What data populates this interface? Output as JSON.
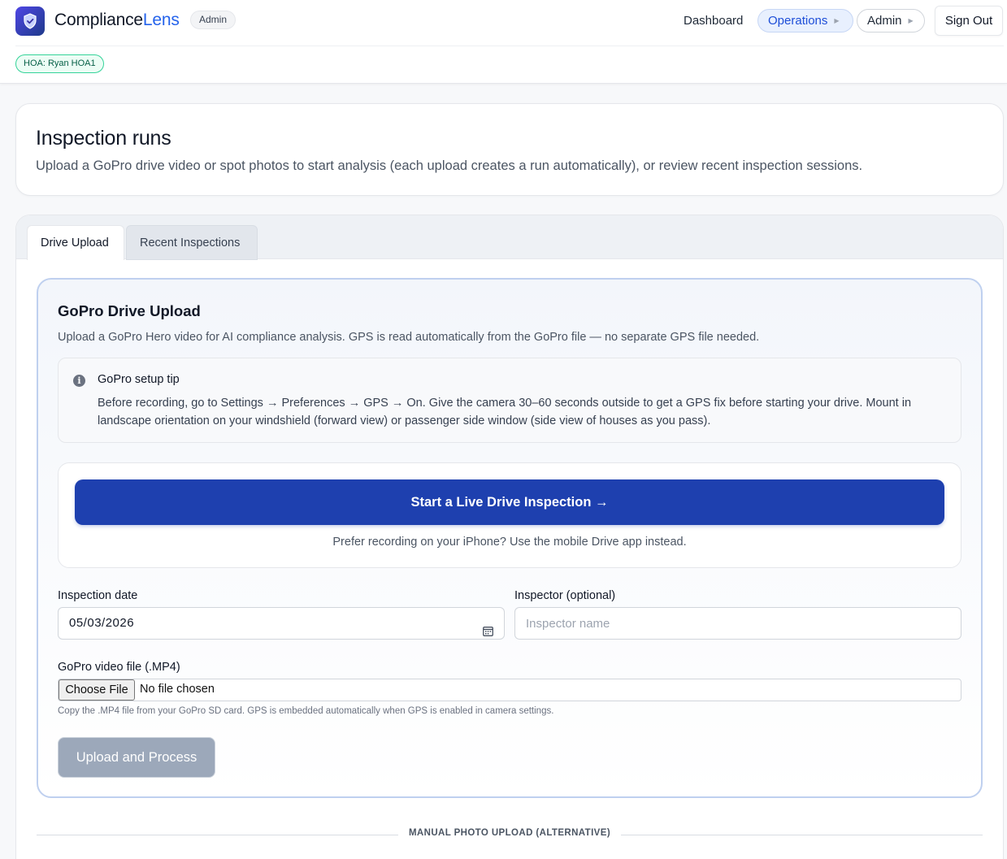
{
  "header": {
    "brand_primary": "Compliance",
    "brand_accent": "Lens",
    "role_badge": "Admin",
    "hoa_badge": "HOA: Ryan HOA1",
    "nav": {
      "dashboard": "Dashboard",
      "operations": "Operations",
      "admin": "Admin"
    },
    "sign_out": "Sign Out"
  },
  "page": {
    "title": "Inspection runs",
    "subtitle": "Upload a GoPro drive video or spot photos to start analysis (each upload creates a run automatically), or review recent inspection sessions."
  },
  "tabs": [
    {
      "label": "Drive Upload",
      "active": true
    },
    {
      "label": "Recent Inspections",
      "active": false
    }
  ],
  "upload": {
    "title": "GoPro Drive Upload",
    "description": "Upload a GoPro Hero video for AI compliance analysis. GPS is read automatically from the GoPro file — no separate GPS file needed.",
    "tip": {
      "title": "GoPro setup tip",
      "body": "Before recording, go to Settings → Preferences → GPS → On. Give the camera 30–60 seconds outside to get a GPS fix before starting your drive. Mount in landscape orientation on your windshield (forward view) or passenger side window (side view of houses as you pass)."
    },
    "live": {
      "button": "Start a Live Drive Inspection →",
      "note": "Prefer recording on your iPhone? Use the mobile Drive app instead."
    },
    "date_field": {
      "label": "Inspection date",
      "value": "05/03/2026"
    },
    "inspector_field": {
      "label": "Inspector (optional)",
      "placeholder": "Inspector name",
      "value": ""
    },
    "file_field": {
      "label": "GoPro video file (.MP4)",
      "button": "Choose File",
      "status": "No file chosen",
      "help": "Copy the .MP4 file from your GoPro SD card. GPS is embedded automatically when GPS is enabled in camera settings."
    },
    "submit": "Upload and Process"
  },
  "divider_label": "MANUAL PHOTO UPLOAD (ALTERNATIVE)",
  "colors": {
    "primary": "#1e40af",
    "accent": "#2563eb",
    "hoa_green": "#34d399",
    "disabled_button": "#9ca8ba"
  }
}
